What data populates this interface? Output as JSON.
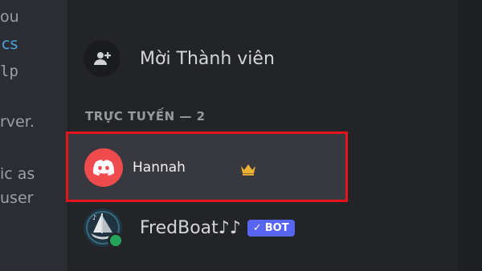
{
  "background_snippets": [
    "ou",
    "cs",
    "lp",
    "rver.",
    "ic as",
    "user"
  ],
  "invite": {
    "label": "Mời Thành viên",
    "icon": "add-user-icon"
  },
  "section": {
    "title": "TRỰC TUYẾN — 2"
  },
  "members": [
    {
      "name": "Hannah",
      "avatar": "discord-logo",
      "badge": "crown-icon",
      "selected": true
    },
    {
      "name": "FredBoat♪♪",
      "avatar": "fredboat-ship",
      "tag": "BOT",
      "status": "online"
    }
  ],
  "colors": {
    "panel": "#232428",
    "selected_row": "#38393f",
    "highlight_border": "#e3141b",
    "discord_red": "#ef4a4e",
    "crown": "#f0b232",
    "bot_tag": "#5865f2",
    "online": "#23a559"
  }
}
